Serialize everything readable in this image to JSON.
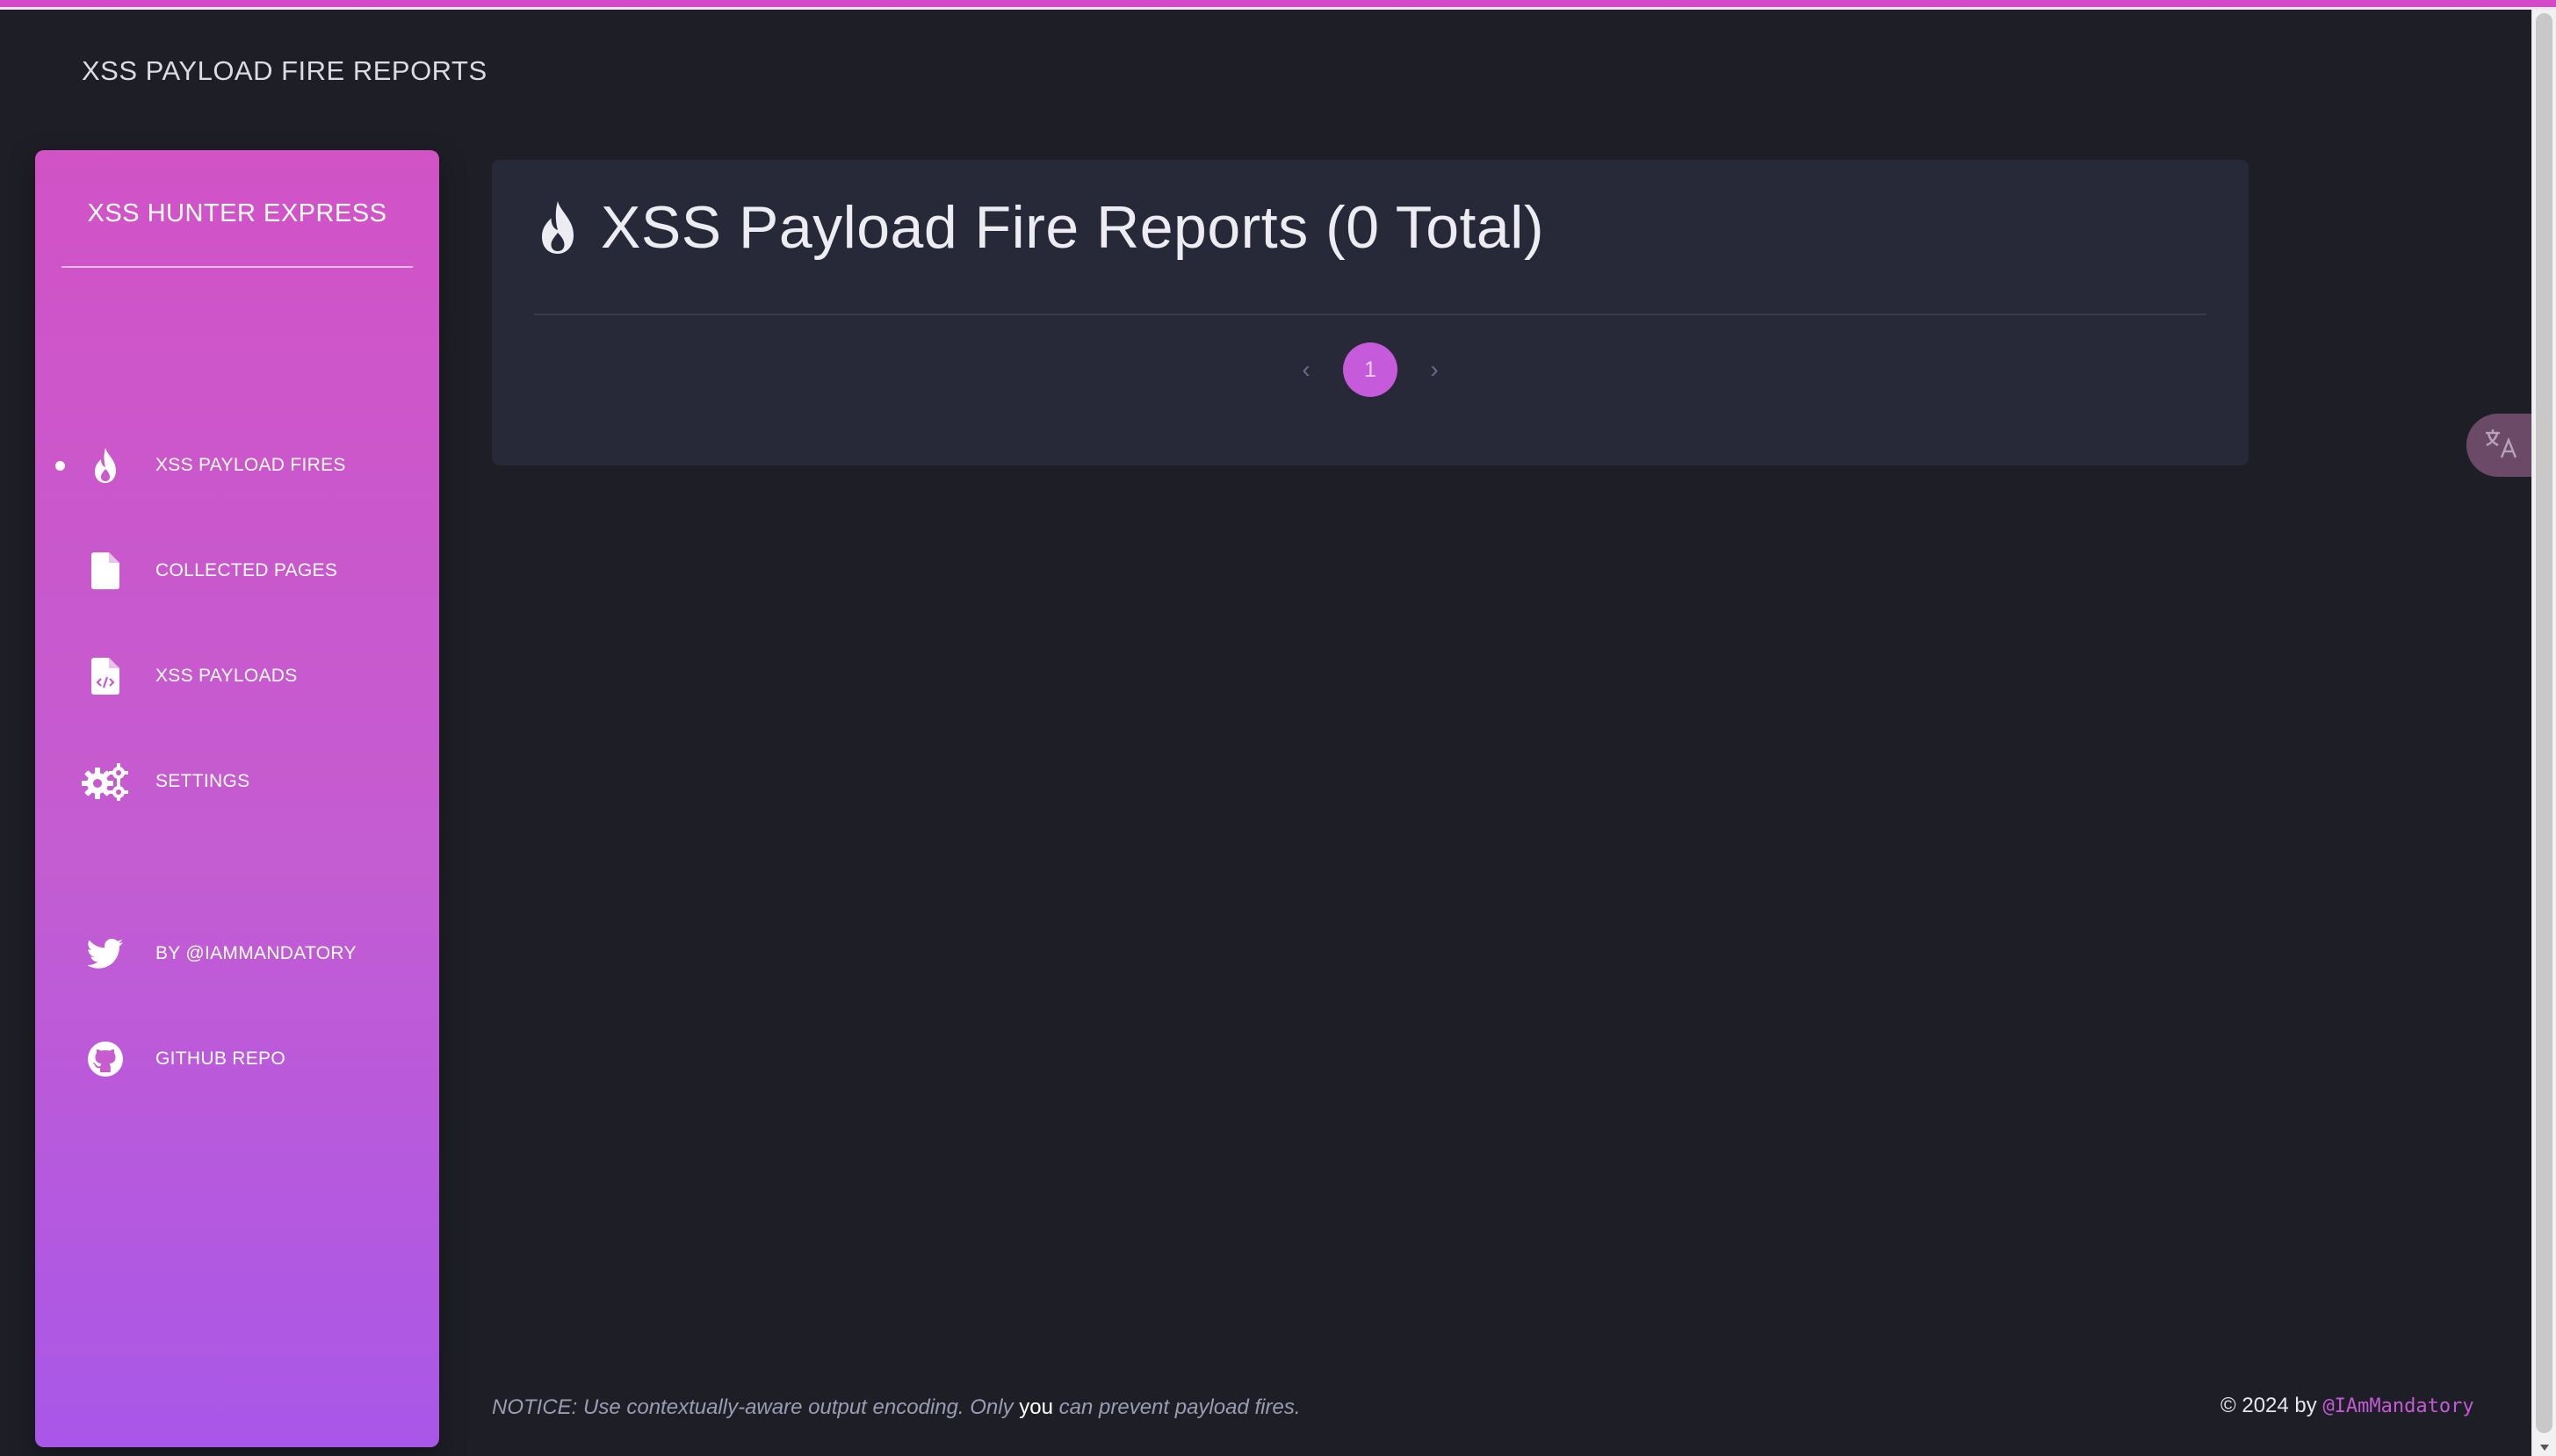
{
  "page": {
    "top_title": "XSS PAYLOAD FIRE REPORTS"
  },
  "sidebar": {
    "brand": "XSS HUNTER EXPRESS",
    "items": [
      {
        "label": "XSS PAYLOAD FIRES",
        "icon": "fire-icon",
        "active": true
      },
      {
        "label": "COLLECTED PAGES",
        "icon": "file-icon",
        "active": false
      },
      {
        "label": "XSS PAYLOADS",
        "icon": "file-code-icon",
        "active": false
      },
      {
        "label": "SETTINGS",
        "icon": "gears-icon",
        "active": false
      }
    ],
    "links": [
      {
        "label": "BY @IAMMANDATORY",
        "icon": "twitter-icon"
      },
      {
        "label": "GITHUB REPO",
        "icon": "github-icon"
      }
    ]
  },
  "main": {
    "title": "XSS Payload Fire Reports (0 Total)",
    "pagination": {
      "current_page": "1",
      "prev": "‹",
      "next": "›"
    }
  },
  "footer": {
    "notice_pre": "NOTICE: Use contextually-aware output encoding. Only ",
    "notice_em": "you",
    "notice_post": " can prevent payload fires.",
    "copyright": "© 2024 by ",
    "handle": "@IAmMandatory"
  },
  "colors": {
    "background": "#1e1e26",
    "card": "#272838",
    "accent": "#c55ada",
    "sidebar_top": "#d153c6",
    "sidebar_bottom": "#a957e8"
  }
}
